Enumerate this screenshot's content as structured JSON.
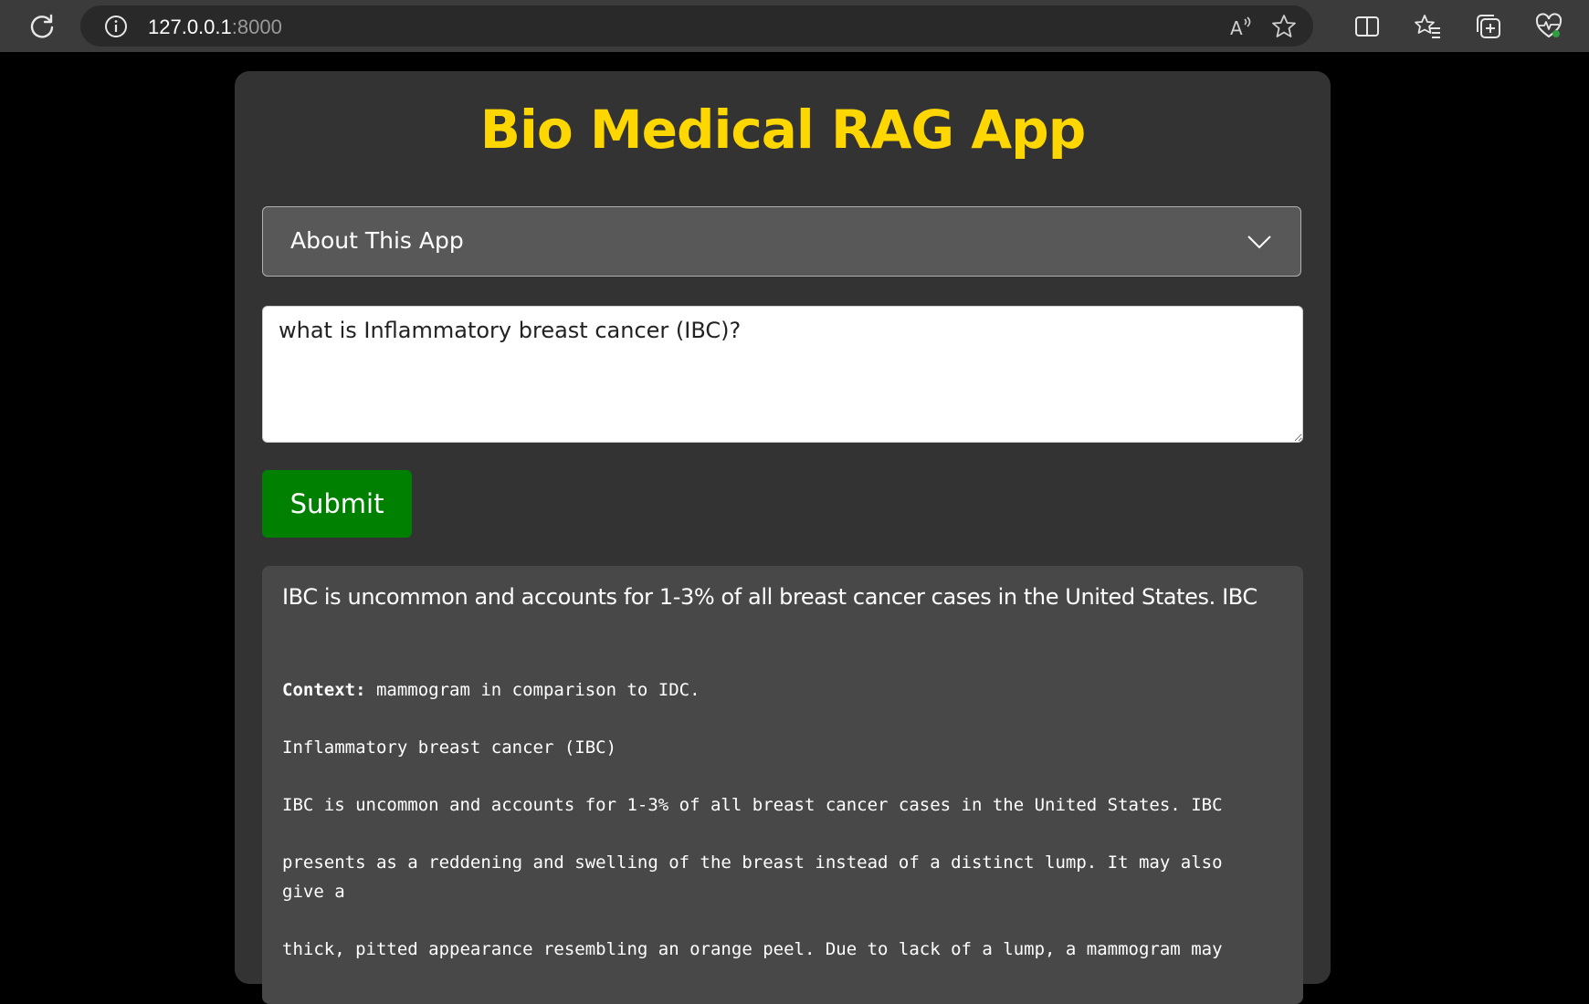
{
  "browser": {
    "url_host": "127.0.0.1",
    "url_port": ":8000",
    "icons": [
      "reload-icon",
      "info-icon",
      "read-aloud-icon",
      "favorite-star-icon",
      "split-screen-icon",
      "favorites-icon",
      "collections-icon",
      "browser-essentials-icon"
    ]
  },
  "app": {
    "title": "Bio Medical RAG App",
    "about_label": "About This App",
    "question_value": "what is Inflammatory breast cancer (IBC)?",
    "submit_label": "Submit"
  },
  "answer": {
    "summary": "IBC is uncommon and accounts for 1-3% of all breast cancer cases in the United States. IBC",
    "context_label": "Context:",
    "context_lines": [
      " mammogram in comparison to IDC.",
      "Inflammatory breast cancer (IBC)",
      "IBC is uncommon and accounts for 1-3% of all breast cancer cases in the United States. IBC",
      "presents as a reddening and swelling of the breast instead of a distinct lump. It may also give a",
      "thick, pitted appearance resembling an orange peel. Due to lack of a lump, a mammogram may"
    ]
  },
  "colors": {
    "title": "#ffd700",
    "submit_bg": "#008000",
    "card_bg": "#333333",
    "answer_bg": "#484848"
  }
}
